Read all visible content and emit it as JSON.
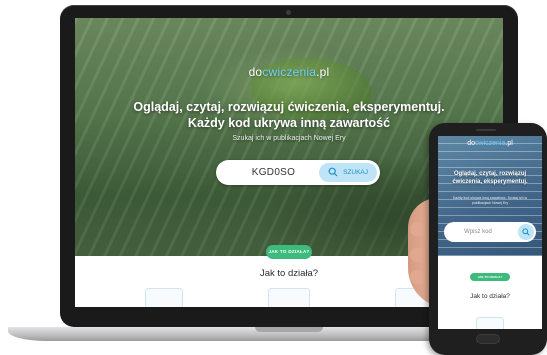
{
  "laptop": {
    "logo": {
      "prefix": "do",
      "highlight": "cwiczenia",
      "suffix": ".pl"
    },
    "headline_line1": "Oglądaj, czytaj, rozwiązuj ćwiczenia, eksperymentuj.",
    "headline_line2": "Każdy kod ukrywa inną zawartość",
    "subline": "Szukaj ich w publikacjach Nowej Ery",
    "search": {
      "value": "KGD0SO",
      "button_label": "SZUKAJ",
      "icon": "search-icon"
    },
    "badge": "JAK TO DZIAŁA?",
    "section_title": "Jak to działa?"
  },
  "phone": {
    "logo": {
      "prefix": "do",
      "highlight": "cwiczenia",
      "suffix": ".pl"
    },
    "headline": "Oglądaj, czytaj, rozwiązuj ćwiczenia, eksperymentuj.",
    "subline": "Każdy kod ukrywa inną zawartość. Szukaj ich w publikacjach Nowej Ery",
    "search": {
      "placeholder": "Wpisz kod",
      "icon": "search-icon"
    },
    "badge": "JAK TO DZIAŁA?",
    "section_title": "Jak to działa?"
  },
  "colors": {
    "accent_blue": "#6fd0ff",
    "button_bg": "#bfe4f7",
    "badge_green": "#3dbb7c"
  }
}
